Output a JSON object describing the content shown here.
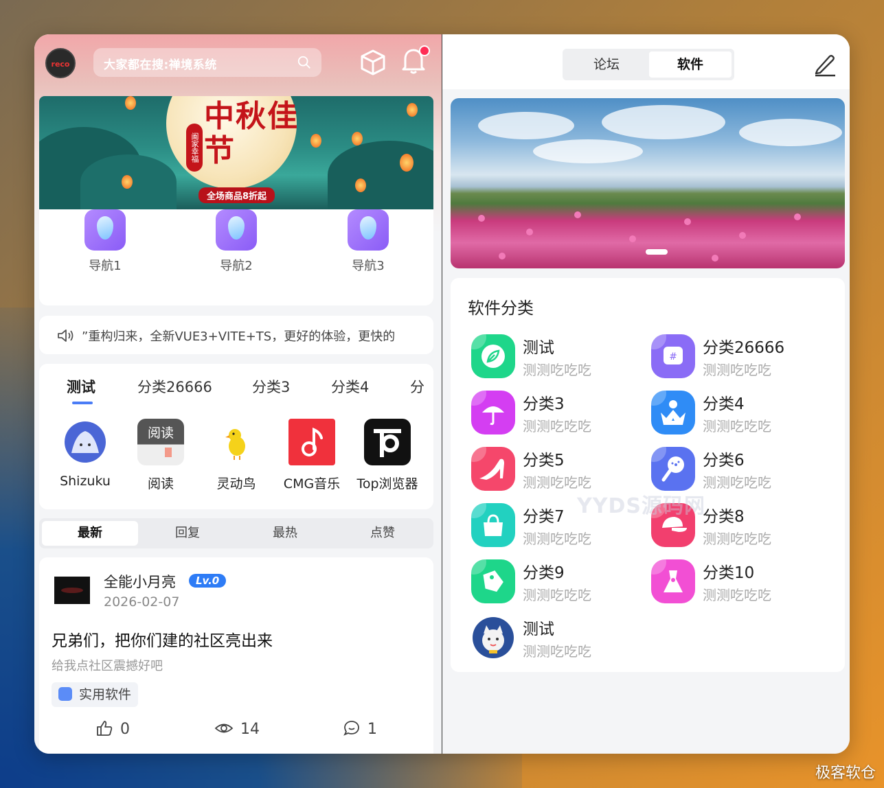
{
  "left": {
    "search": {
      "text": "大家都在搜:禅境系统"
    },
    "logo": {
      "text": "reco"
    },
    "banner": {
      "festival": "中秋佳节",
      "seal": "阖家幸福",
      "promo": "全场商品8折起"
    },
    "nav": [
      {
        "label": "导航1"
      },
      {
        "label": "导航2"
      },
      {
        "label": "导航3"
      }
    ],
    "notice": {
      "text": "”重构归来，全新VUE3+VITE+TS，更好的体验，更快的"
    },
    "categories": [
      {
        "label": "测试",
        "active": true
      },
      {
        "label": "分类26666"
      },
      {
        "label": "分类3"
      },
      {
        "label": "分类4"
      },
      {
        "label": "分"
      }
    ],
    "apps": [
      {
        "label": "Shizuku",
        "icon": "shizuku-icon"
      },
      {
        "label": "阅读",
        "icon": "reader-icon",
        "icon_text": "阅读"
      },
      {
        "label": "灵动鸟",
        "icon": "bird-icon"
      },
      {
        "label": "CMG音乐",
        "icon": "music-icon"
      },
      {
        "label": "Top浏览器",
        "icon": "browser-icon"
      }
    ],
    "sort_tabs": [
      {
        "label": "最新",
        "active": true
      },
      {
        "label": "回复"
      },
      {
        "label": "最热"
      },
      {
        "label": "点赞"
      }
    ],
    "post": {
      "user": "全能小月亮",
      "level": "Lv.0",
      "date": "2026-02-07",
      "title": "兄弟们，把你们建的社区亮出来",
      "subtitle": "给我点社区震撼好吧",
      "tag": "实用软件",
      "likes": "0",
      "views": "14",
      "comments": "1"
    }
  },
  "right": {
    "segments": [
      {
        "label": "论坛"
      },
      {
        "label": "软件",
        "active": true
      }
    ],
    "section_title": "软件分类",
    "categories": [
      {
        "name": "测试",
        "desc": "测测吃吃吃",
        "color": "#1ed68a",
        "icon": "leaf-icon"
      },
      {
        "name": "分类26666",
        "desc": "测测吃吃吃",
        "color": "#8a6cf6",
        "icon": "hashtag-icon"
      },
      {
        "name": "分类3",
        "desc": "测测吃吃吃",
        "color": "#d43ef2",
        "icon": "umbrella-icon"
      },
      {
        "name": "分类4",
        "desc": "测测吃吃吃",
        "color": "#2f8cf6",
        "icon": "crown-icon"
      },
      {
        "name": "分类5",
        "desc": "测测吃吃吃",
        "color": "#f5476b",
        "icon": "heel-icon"
      },
      {
        "name": "分类6",
        "desc": "测测吃吃吃",
        "color": "#5a72f0",
        "icon": "microphone-icon"
      },
      {
        "name": "分类7",
        "desc": "测测吃吃吃",
        "color": "#22d1c0",
        "icon": "bag-icon"
      },
      {
        "name": "分类8",
        "desc": "测测吃吃吃",
        "color": "#f23f6e",
        "icon": "cap-icon"
      },
      {
        "name": "分类9",
        "desc": "测测吃吃吃",
        "color": "#1ed68a",
        "icon": "tag-icon"
      },
      {
        "name": "分类10",
        "desc": "测测吃吃吃",
        "color": "#f24fd4",
        "icon": "dress-icon"
      },
      {
        "name": "测试",
        "desc": "测测吃吃吃",
        "color": "#2a4f9a",
        "icon": "cat-avatar-icon"
      }
    ]
  },
  "watermark": "YYDS源码网",
  "corner_mark": "极客软仓"
}
